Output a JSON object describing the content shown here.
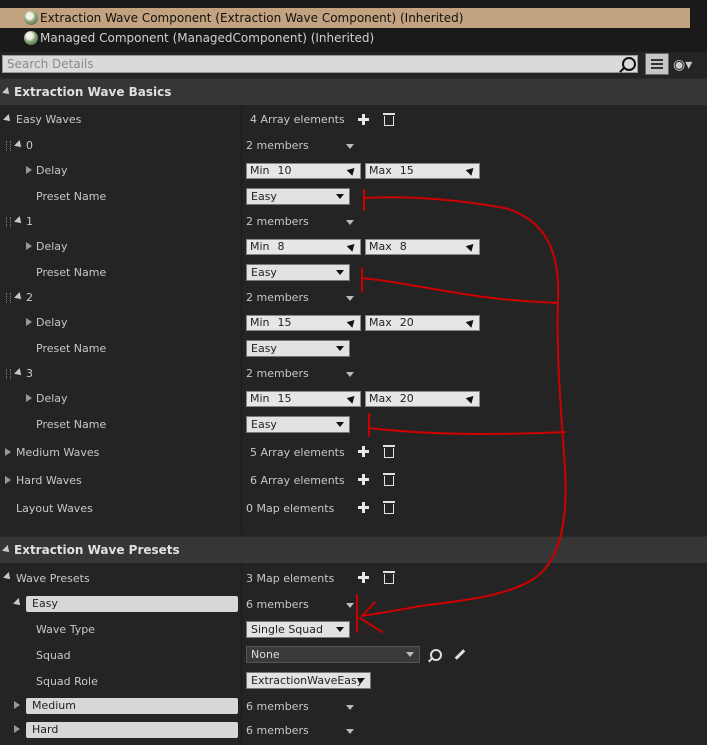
{
  "components": [
    {
      "label": "Extraction Wave Component (Extraction Wave Component) (Inherited)",
      "selected": true
    },
    {
      "label": "Managed Component (ManagedComponent) (Inherited)",
      "selected": false
    }
  ],
  "search": {
    "placeholder": "Search Details"
  },
  "icons": {
    "search": "search-icon",
    "view_options": "list-view-icon",
    "visibility": "eye-icon"
  },
  "basics": {
    "title": "Extraction Wave Basics",
    "easy_waves": {
      "label": "Easy Waves",
      "count": "4 Array elements",
      "elements": [
        {
          "index": "0",
          "members": "2 members",
          "delay_label": "Delay",
          "min_label": "Min",
          "min": "10",
          "max_label": "Max",
          "max": "15",
          "preset_label": "Preset Name",
          "preset": "Easy"
        },
        {
          "index": "1",
          "members": "2 members",
          "delay_label": "Delay",
          "min_label": "Min",
          "min": "8",
          "max_label": "Max",
          "max": "8",
          "preset_label": "Preset Name",
          "preset": "Easy"
        },
        {
          "index": "2",
          "members": "2 members",
          "delay_label": "Delay",
          "min_label": "Min",
          "min": "15",
          "max_label": "Max",
          "max": "20",
          "preset_label": "Preset Name",
          "preset": "Easy"
        },
        {
          "index": "3",
          "members": "2 members",
          "delay_label": "Delay",
          "min_label": "Min",
          "min": "15",
          "max_label": "Max",
          "max": "20",
          "preset_label": "Preset Name",
          "preset": "Easy"
        }
      ]
    },
    "medium_waves": {
      "label": "Medium Waves",
      "count": "5 Array elements"
    },
    "hard_waves": {
      "label": "Hard Waves",
      "count": "6 Array elements"
    },
    "layout_waves": {
      "label": "Layout Waves",
      "count": "0 Map elements"
    }
  },
  "presets": {
    "title": "Extraction Wave Presets",
    "wave_presets": {
      "label": "Wave Presets",
      "count": "3 Map elements"
    },
    "easy": {
      "key": "Easy",
      "members": "6 members",
      "wave_type_label": "Wave Type",
      "wave_type": "Single Squad",
      "squad_label": "Squad",
      "squad": "None",
      "squad_role_label": "Squad Role",
      "squad_role": "ExtractionWaveEasy"
    },
    "medium": {
      "key": "Medium",
      "members": "6 members"
    },
    "hard": {
      "key": "Hard",
      "members": "6 members"
    }
  },
  "annotation_color": "#cc0000"
}
